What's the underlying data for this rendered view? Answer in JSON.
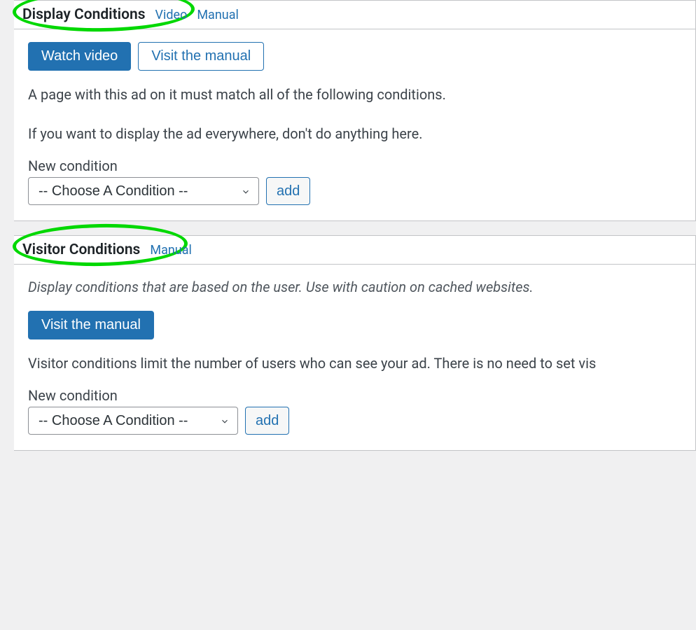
{
  "display": {
    "title": "Display Conditions",
    "links": {
      "video": "Video",
      "manual": "Manual"
    },
    "buttons": {
      "watch_video": "Watch video",
      "visit_manual": "Visit the manual"
    },
    "text1": "A page with this ad on it must match all of the following conditions.",
    "text2": "If you want to display the ad everywhere, don't do anything here.",
    "new_condition_label": "New condition",
    "select_placeholder": "-- Choose A Condition --",
    "add_label": "add"
  },
  "visitor": {
    "title": "Visitor Conditions",
    "links": {
      "manual": "Manual"
    },
    "intro": "Display conditions that are based on the user. Use with caution on cached websites.",
    "buttons": {
      "visit_manual": "Visit the manual"
    },
    "text1": "Visitor conditions limit the number of users who can see your ad. There is no need to set vis",
    "new_condition_label": "New condition",
    "select_placeholder": "-- Choose A Condition --",
    "add_label": "add"
  }
}
